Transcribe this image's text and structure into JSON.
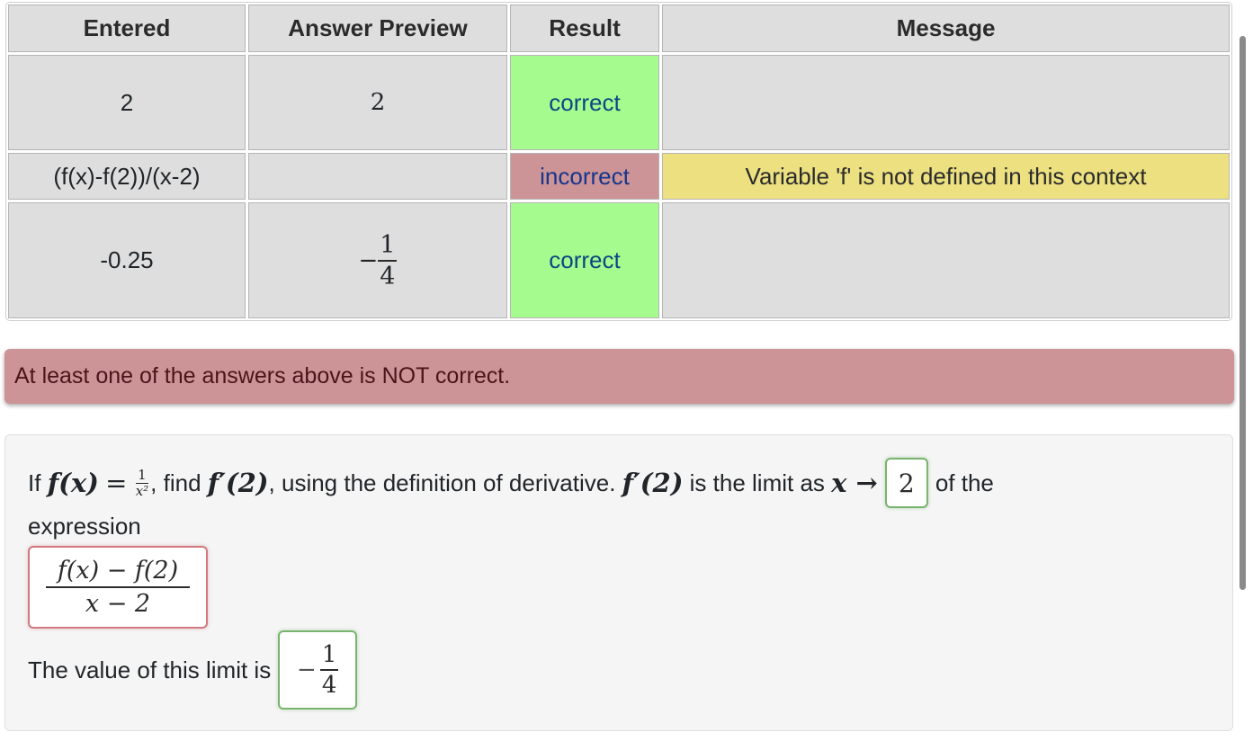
{
  "results_table": {
    "headers": {
      "entered": "Entered",
      "preview": "Answer Preview",
      "result": "Result",
      "message": "Message"
    },
    "rows": [
      {
        "entered": "2",
        "preview": "2",
        "result": "correct",
        "message": ""
      },
      {
        "entered": "(f(x)-f(2))/(x-2)",
        "preview": "",
        "result": "incorrect",
        "message": "Variable 'f' is not defined in this context"
      },
      {
        "entered": "-0.25",
        "preview_sign": "−",
        "preview_num": "1",
        "preview_den": "4",
        "result": "correct",
        "message": ""
      }
    ]
  },
  "alert": {
    "text": "At least one of the answers above is NOT correct."
  },
  "problem": {
    "if_text": "If",
    "fx": "f(x)",
    "equals": "=",
    "def_num": "1",
    "def_den": "x²",
    "find_text": ", find",
    "fprime2": "f′(2)",
    "definition_text": ", using the definition of derivative.",
    "fprime2_b": "f′(2)",
    "limit_text": "is the limit as",
    "x_to": "x →",
    "of_the_text": "of the",
    "expression_text": "expression",
    "answer_point": "2",
    "expr_num": "f(x) − f(2)",
    "expr_den": "x − 2",
    "value_text": "The value of this limit is",
    "limit_sign": "−",
    "limit_num": "1",
    "limit_den": "4"
  },
  "colors": {
    "correct_bg": "#a6fb8f",
    "incorrect_bg": "#cc9496",
    "message_warn_bg": "#ece081",
    "alert_bg": "#cc9496",
    "correct_box_border": "#78b46e",
    "incorrect_box_border": "#d07a7f"
  }
}
